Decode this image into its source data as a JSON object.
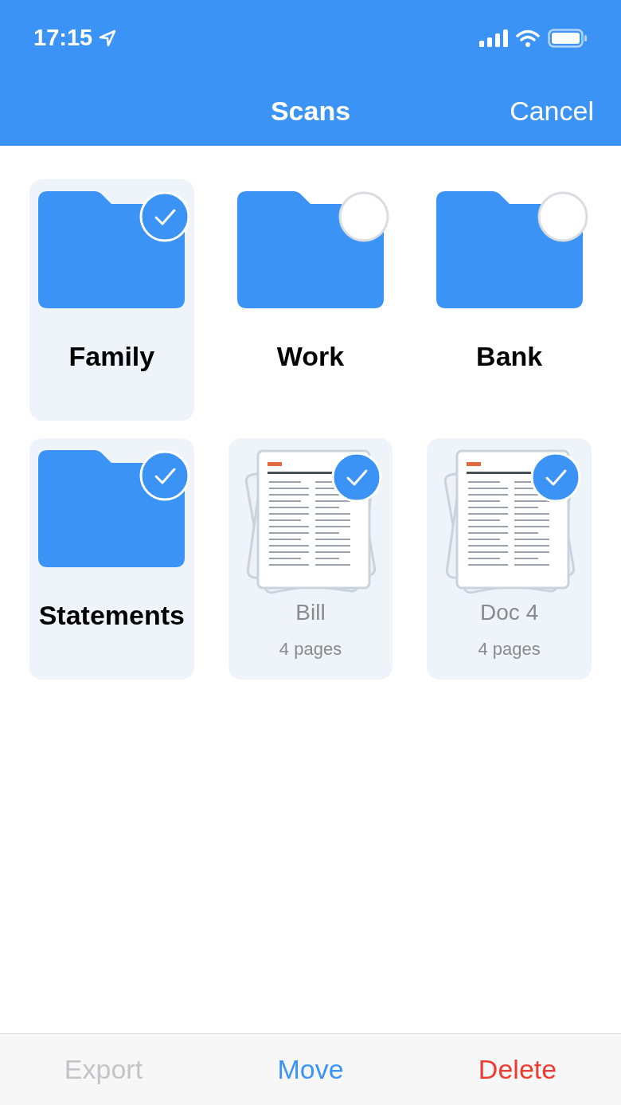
{
  "status_bar": {
    "time": "17:15"
  },
  "nav": {
    "title": "Scans",
    "action": "Cancel"
  },
  "items": [
    {
      "kind": "folder",
      "name": "Family",
      "selected": true
    },
    {
      "kind": "folder",
      "name": "Work",
      "selected": false
    },
    {
      "kind": "folder",
      "name": "Bank",
      "selected": false
    },
    {
      "kind": "folder",
      "name": "Statements",
      "selected": true
    },
    {
      "kind": "document",
      "name": "Bill",
      "pages": "4 pages",
      "selected": true
    },
    {
      "kind": "document",
      "name": "Doc 4",
      "pages": "4 pages",
      "selected": true
    }
  ],
  "toolbar": [
    {
      "label": "Export",
      "kind": "normal",
      "disabled": true
    },
    {
      "label": "Move",
      "kind": "normal",
      "disabled": false
    },
    {
      "label": "Delete",
      "kind": "destructive",
      "disabled": false
    }
  ]
}
